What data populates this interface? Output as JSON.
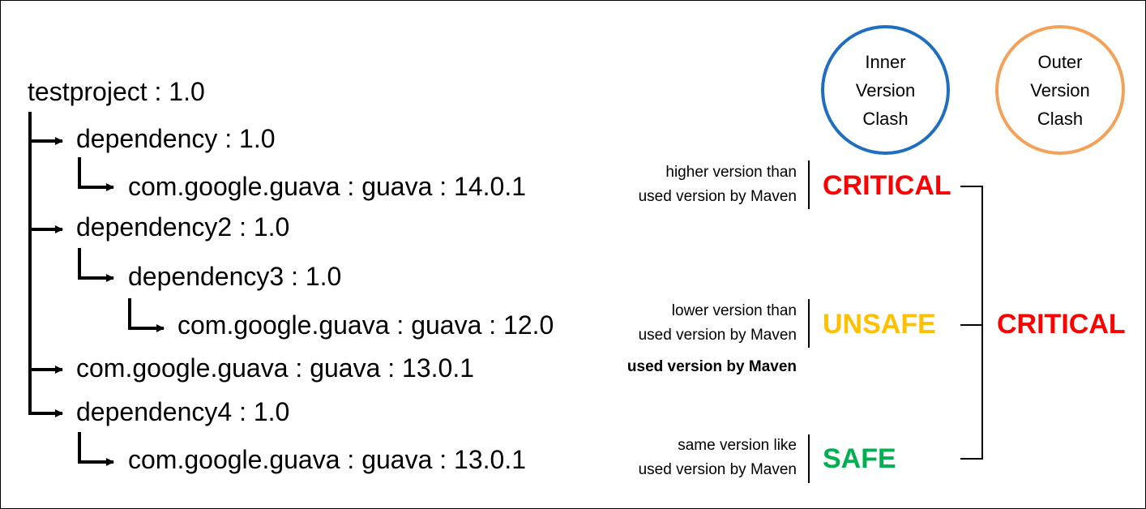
{
  "tree": {
    "root": "testproject : 1.0",
    "nodes": [
      {
        "id": "dep1",
        "label": "dependency : 1.0"
      },
      {
        "id": "dep1-guava",
        "label": "com.google.guava : guava : 14.0.1"
      },
      {
        "id": "dep2",
        "label": "dependency2 : 1.0"
      },
      {
        "id": "dep3",
        "label": "dependency3 : 1.0"
      },
      {
        "id": "dep3-guava",
        "label": "com.google.guava : guava : 12.0"
      },
      {
        "id": "direct-guava",
        "label": "com.google.guava : guava : 13.0.1"
      },
      {
        "id": "dep4",
        "label": "dependency4 : 1.0"
      },
      {
        "id": "dep4-guava",
        "label": "com.google.guava : guava : 13.0.1"
      }
    ]
  },
  "legend": {
    "inner": {
      "label": "Inner\nVersion\nClash",
      "color": "#1f6fbf"
    },
    "outer": {
      "label": "Outer\nVersion\nClash",
      "color": "#f4a259"
    }
  },
  "notes": {
    "higher": "higher version than\nused version by Maven",
    "lower": "lower version than\nused version by Maven",
    "used": "used version by Maven",
    "same": "same version like\nused version by Maven"
  },
  "levels": {
    "critical_inner": {
      "label": "CRITICAL",
      "color": "#ff0000"
    },
    "unsafe": {
      "label": "UNSAFE",
      "color": "#ffc000"
    },
    "safe": {
      "label": "SAFE",
      "color": "#00b050"
    },
    "critical_outer": {
      "label": "CRITICAL",
      "color": "#ff0000"
    }
  }
}
